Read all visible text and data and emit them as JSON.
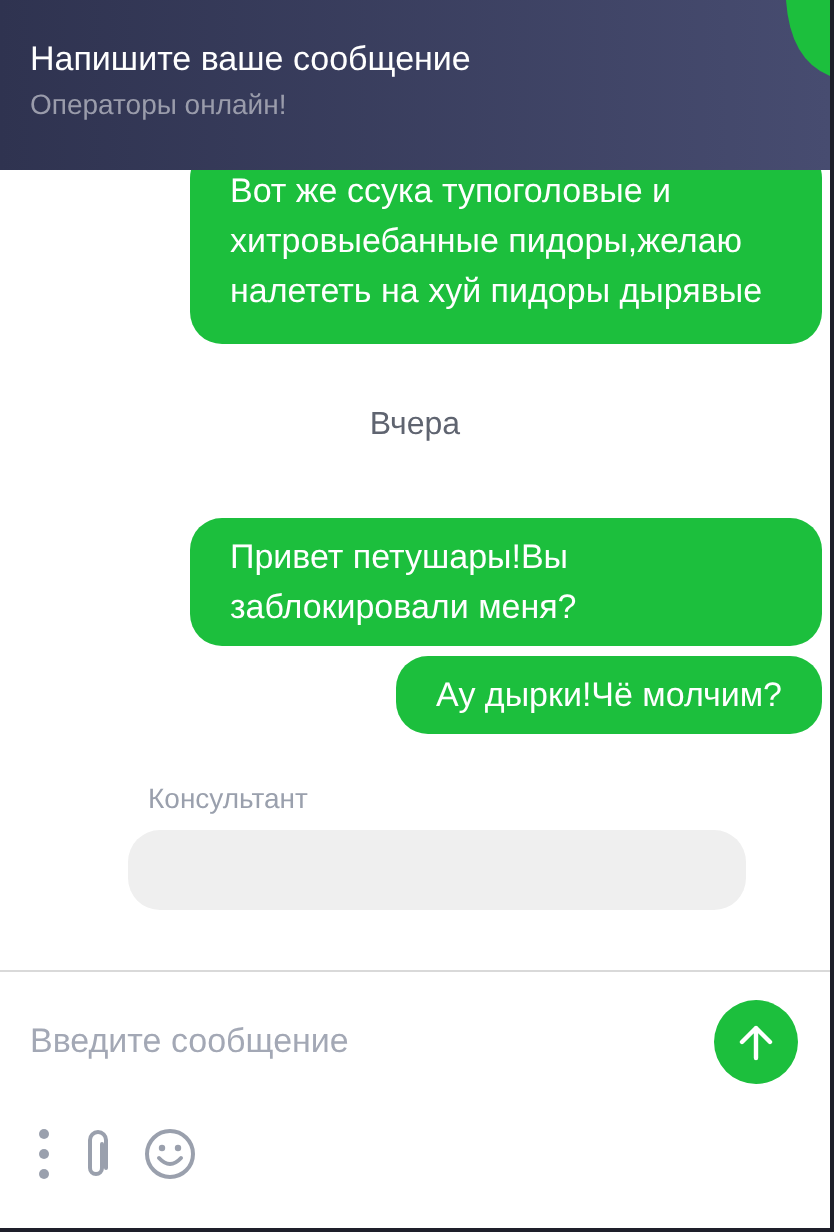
{
  "header": {
    "title": "Напишите ваше сообщение",
    "subtitle": "Операторы онлайн!"
  },
  "messages": [
    {
      "kind": "outgoing",
      "text": "Вот же ссука тупоголовые и хитровыебанные пидоры,желаю налететь на хуй пидоры дырявые"
    },
    {
      "kind": "date",
      "text": "Вчера"
    },
    {
      "kind": "outgoing",
      "text": "Привет петушары!Вы заблокировали меня?"
    },
    {
      "kind": "outgoing",
      "text": "Ау дырки!Чё молчим?"
    },
    {
      "kind": "incoming",
      "sender": "Консультант"
    }
  ],
  "composer": {
    "placeholder": "Введите сообщение"
  }
}
